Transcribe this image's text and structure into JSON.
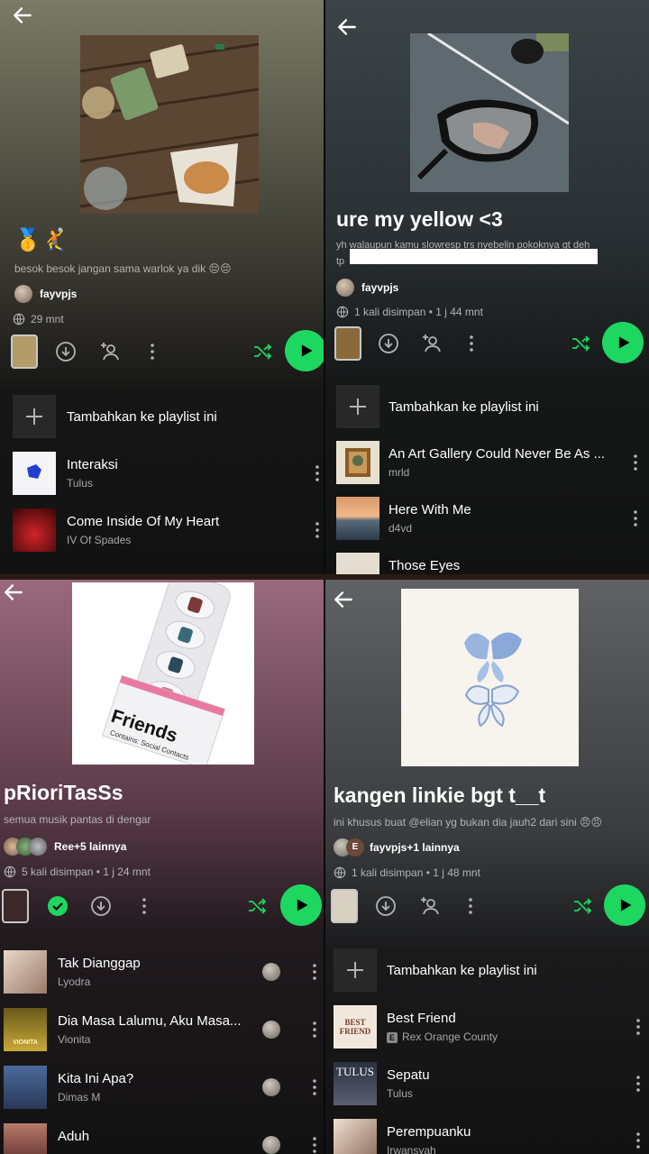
{
  "colors": {
    "accent": "#1ed760",
    "background": "#121212",
    "secondary_text": "#b3b3b3"
  },
  "panel1": {
    "title_emoji": "🥇🤾",
    "description": "besok besok jangan sama warlok ya dik 😔😔",
    "owner": "fayvpjs",
    "meta": "29 mnt",
    "add_label": "Tambahkan ke playlist ini",
    "tracks": [
      {
        "title": "Interaksi",
        "artist": "Tulus"
      },
      {
        "title": "Come Inside Of My Heart",
        "artist": "IV Of Spades"
      }
    ]
  },
  "panel2": {
    "title": "ure my yellow <3",
    "description": "yh walaupun kamu slowresp trs nyebelin pokoknya gt deh",
    "description_line2": "tp",
    "owner": "fayvpjs",
    "meta": "1 kali disimpan • 1 j 44 mnt",
    "add_label": "Tambahkan ke playlist ini",
    "tracks": [
      {
        "title": "An Art Gallery Could Never Be As ...",
        "artist": "mrld"
      },
      {
        "title": "Here With Me",
        "artist": "d4vd"
      },
      {
        "title": "Those Eyes",
        "artist": ""
      }
    ]
  },
  "panel3": {
    "cover_text": "Friends",
    "cover_subtext": "Contains: Social Contacts",
    "title": "pRioriTasSs",
    "description": "semua musik pantas di dengar",
    "owner": "Ree+5 lainnya",
    "meta": "5 kali disimpan • 1 j 24 mnt",
    "tracks": [
      {
        "title": "Tak Dianggap",
        "artist": "Lyodra"
      },
      {
        "title": "Dia Masa Lalumu, Aku Masa...",
        "artist": "Vionita",
        "art_text": "VIONITA"
      },
      {
        "title": "Kita Ini Apa?",
        "artist": "Dimas M"
      },
      {
        "title": "Aduh",
        "artist": ""
      }
    ]
  },
  "panel4": {
    "title": "kangen linkie bgt t__t",
    "description": "ini khusus buat @elian yg bukan dia jauh2 dari sini 😠😠",
    "owner": "fayvpjs+1 lainnya",
    "owner_initial": "E",
    "meta": "1 kali disimpan • 1 j 48 mnt",
    "add_label": "Tambahkan ke playlist ini",
    "tracks": [
      {
        "title": "Best Friend",
        "artist": "Rex Orange County",
        "badge": "E",
        "art_text": "BEST FRIEND"
      },
      {
        "title": "Sepatu",
        "artist": "Tulus",
        "art_text": "TULUS"
      },
      {
        "title": "Perempuanku",
        "artist": "Irwansyah"
      }
    ]
  }
}
